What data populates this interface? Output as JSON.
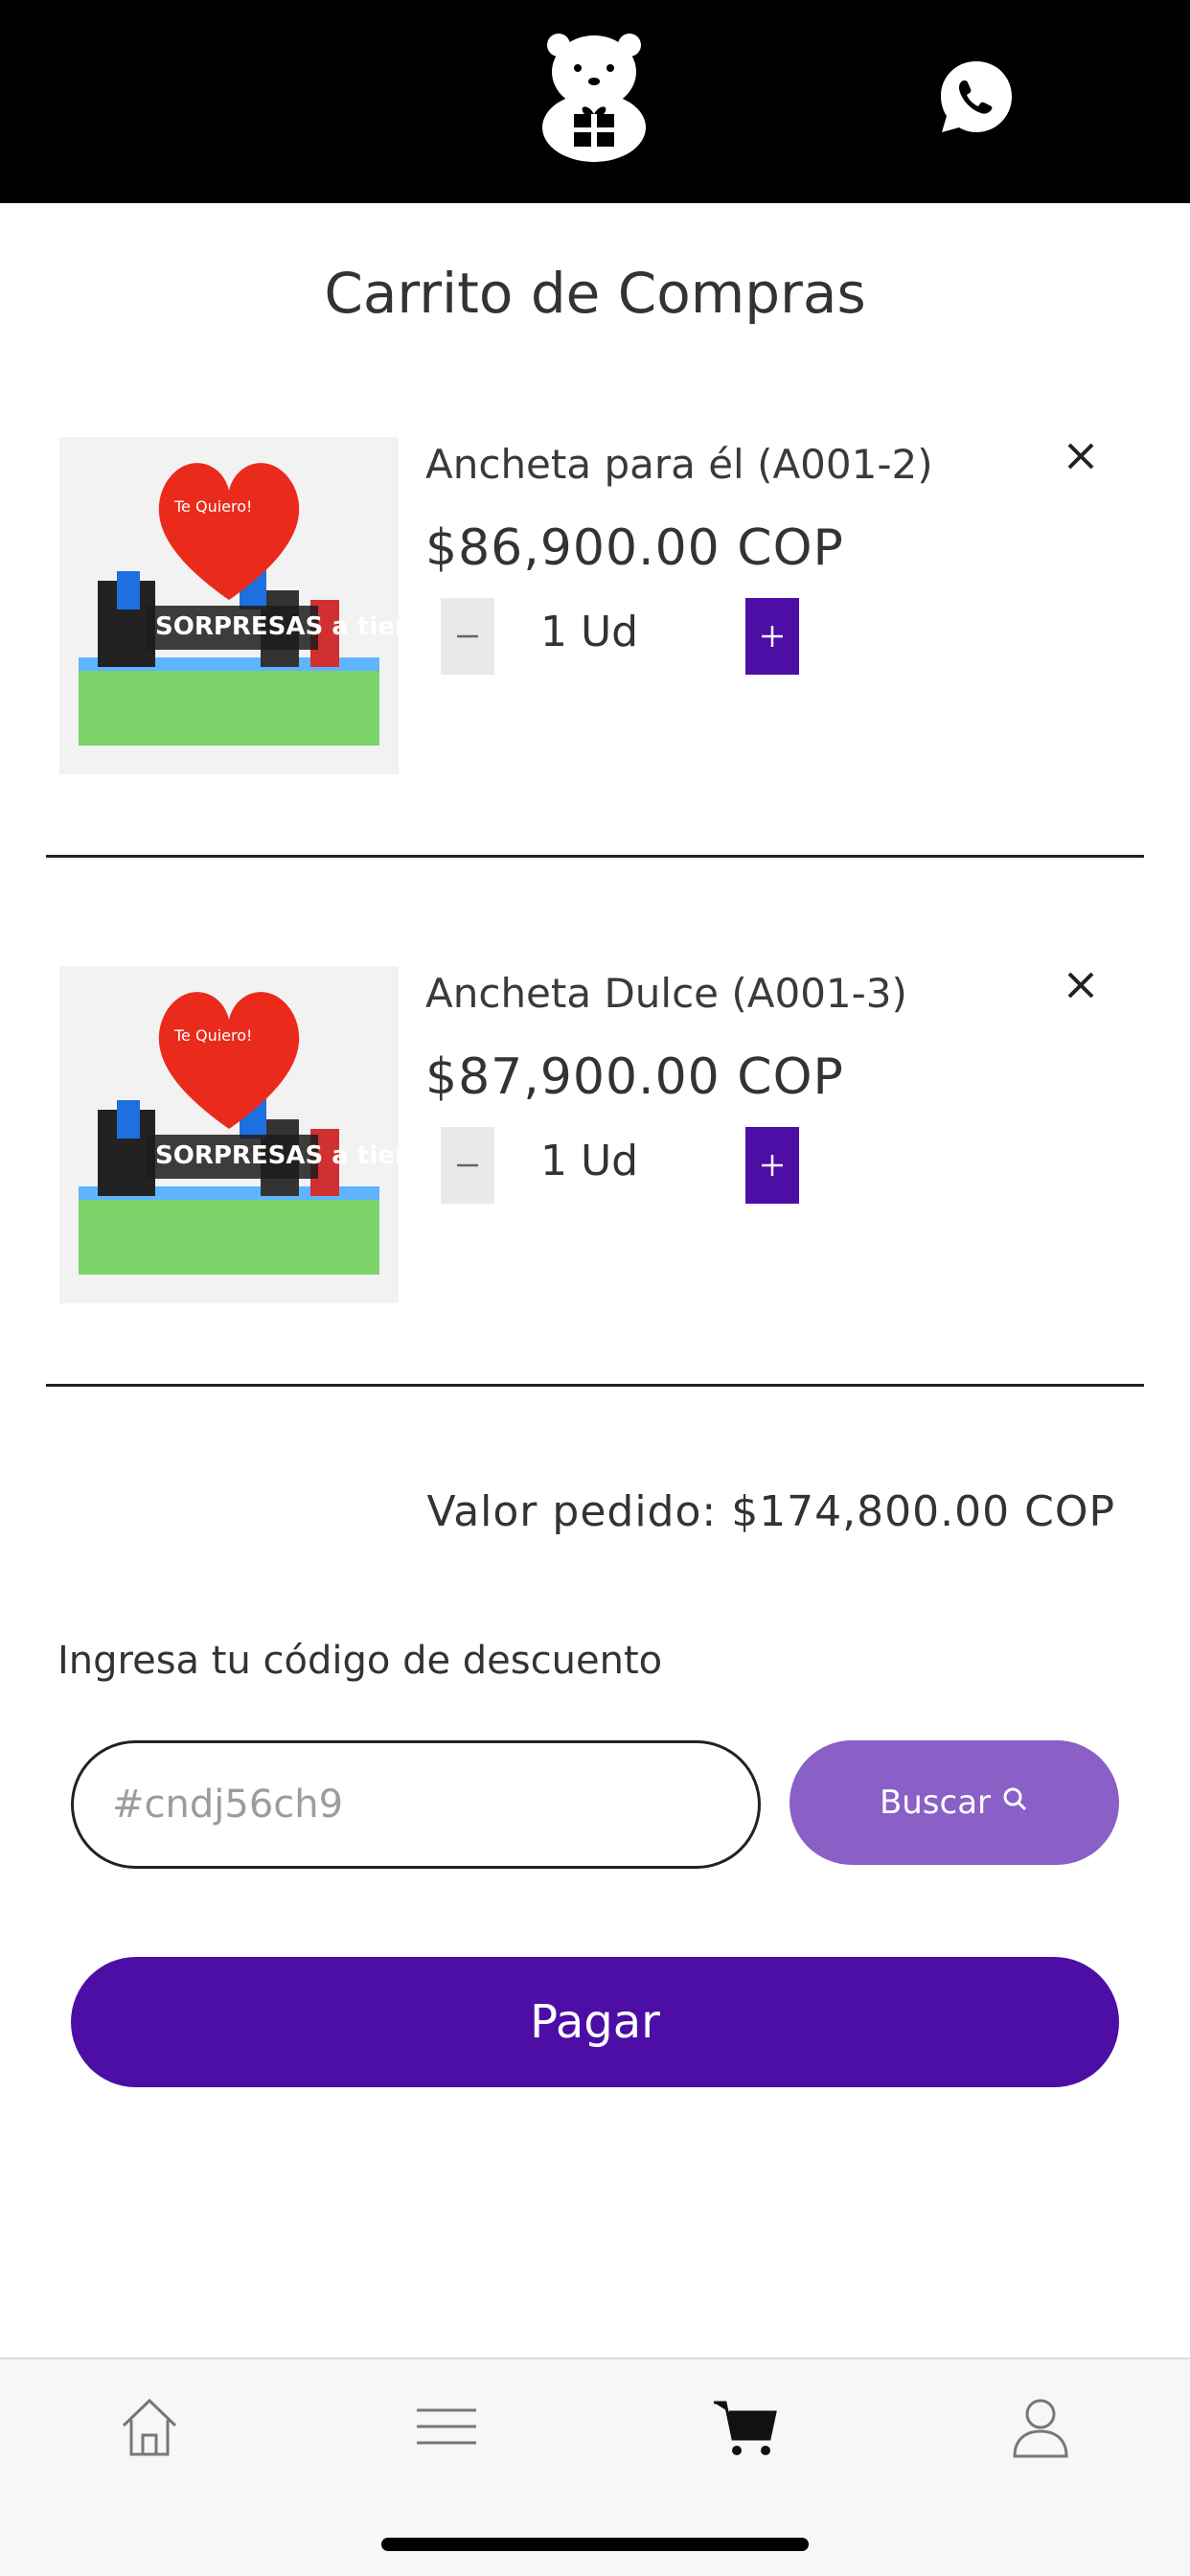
{
  "page": {
    "title": "Carrito de Compras"
  },
  "cart": {
    "items": [
      {
        "name": "Ancheta para él (A001-2)",
        "price": "$86,900.00 COP",
        "quantity": "1 Ud",
        "image_text": [
          "Te Quiero!",
          "SORPRESAS a tiempo"
        ]
      },
      {
        "name": "Ancheta Dulce (A001-3)",
        "price": "$87,900.00 COP",
        "quantity": "1 Ud",
        "image_text": [
          "Te Quiero!",
          "SORPRESAS a tiempo"
        ]
      }
    ],
    "order_total": "Valor pedido: $174,800.00 COP"
  },
  "discount": {
    "label": "Ingresa tu código de descuento",
    "placeholder": "#cndj56ch9",
    "button_label": "Buscar"
  },
  "pay": {
    "label": "Pagar"
  },
  "colors": {
    "header_bg": "#000000",
    "accent": "#4c0ea5",
    "search_button": "#8a5fc6"
  },
  "icons": {
    "logo": "bear-gift-icon",
    "whatsapp": "whatsapp-icon",
    "remove": "close-icon",
    "search": "search-icon"
  },
  "tabbar": [
    "home-icon",
    "menu-icon",
    "cart-icon",
    "user-icon"
  ]
}
